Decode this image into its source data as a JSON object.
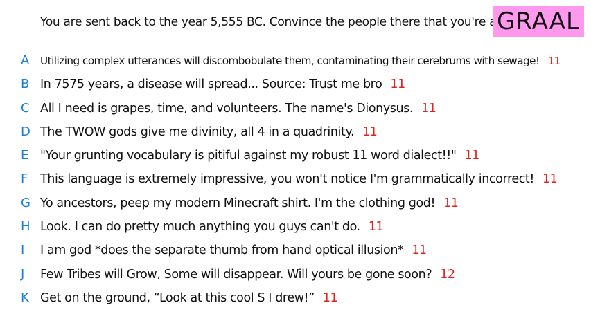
{
  "prompt": "You are sent back to the year 5,555 BC. Convince the people there that you're a god.",
  "badge": "GRAAL",
  "colors": {
    "letter": "#1a7fd6",
    "count": "#e0201b",
    "badge_bg": "#ff99ee",
    "text": "#111111"
  },
  "responses": [
    {
      "letter": "A",
      "text": "Utilizing complex utterances will discombobulate them, contaminating their cerebrums with sewage!",
      "count": "11"
    },
    {
      "letter": "B",
      "text": "In 7575 years, a disease will spread... Source: Trust me bro",
      "count": "11"
    },
    {
      "letter": "C",
      "text": "All I need is grapes, time, and volunteers. The name's Dionysus.",
      "count": "11"
    },
    {
      "letter": "D",
      "text": "The TWOW gods give me divinity, all 4 in a quadrinity.",
      "count": "11"
    },
    {
      "letter": "E",
      "text": "\"Your grunting vocabulary is pitiful against my robust 11 word dialect!!\"",
      "count": "11"
    },
    {
      "letter": "F",
      "text": "This language is extremely impressive, you won't notice I'm grammatically incorrect!",
      "count": "11"
    },
    {
      "letter": "G",
      "text": "Yo ancestors, peep my modern Minecraft shirt. I'm the clothing god!",
      "count": "11"
    },
    {
      "letter": "H",
      "text": "Look. I can do pretty much anything you guys can't do.",
      "count": "11"
    },
    {
      "letter": "I",
      "text": "I am god *does the separate thumb from hand optical illusion*",
      "count": "11"
    },
    {
      "letter": "J",
      "text": "Few Tribes will Grow, Some will disappear. Will yours be gone soon?",
      "count": "12"
    },
    {
      "letter": "K",
      "text": "Get on the ground, “Look at this cool S I drew!”",
      "count": "11"
    }
  ]
}
